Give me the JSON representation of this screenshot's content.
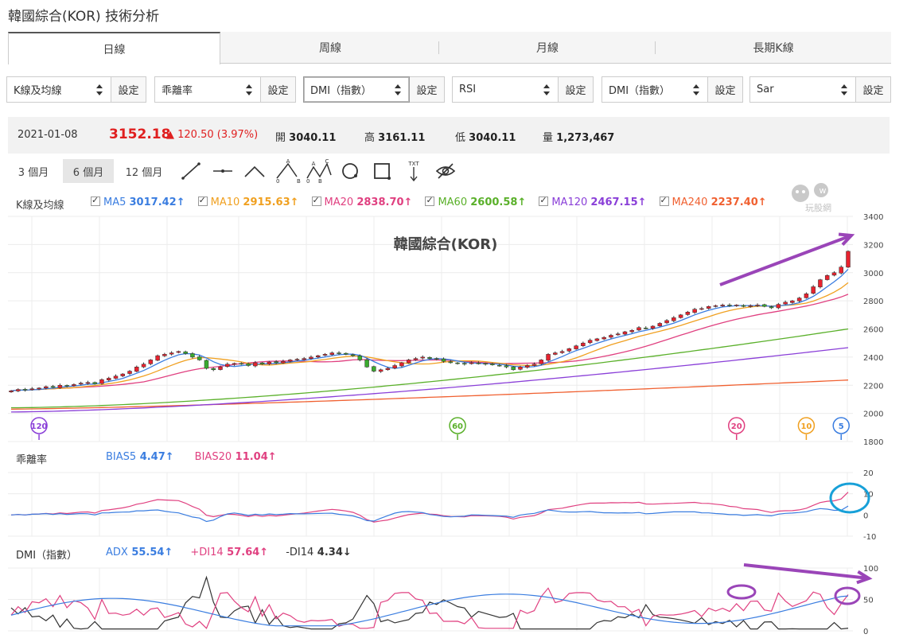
{
  "title": "韓國綜合(KOR) 技術分析",
  "tabs": [
    {
      "label": "日線",
      "active": true
    },
    {
      "label": "周線",
      "active": false
    },
    {
      "label": "月線",
      "active": false
    },
    {
      "label": "長期K線",
      "active": false
    }
  ],
  "controls": [
    {
      "label": "K線及均線",
      "set": "設定",
      "active": false
    },
    {
      "label": "乖離率",
      "set": "設定",
      "active": false
    },
    {
      "label": "DMI（指數）",
      "set": "設定",
      "active": true
    },
    {
      "label": "RSI",
      "set": "設定",
      "active": false
    },
    {
      "label": "DMI（指數）",
      "set": "設定",
      "active": false
    },
    {
      "label": "Sar",
      "set": "設定",
      "active": false
    }
  ],
  "quote": {
    "date": "2021-01-08",
    "price": "3152.18",
    "change": "▲ 120.50 (3.97%)",
    "open_label": "開",
    "open": "3040.11",
    "high_label": "高",
    "high": "3161.11",
    "low_label": "低",
    "low": "3040.11",
    "vol_label": "量",
    "vol": "1,273,467"
  },
  "periods": [
    {
      "label": "3 個月",
      "active": false
    },
    {
      "label": "6 個月",
      "active": true
    },
    {
      "label": "12 個月",
      "active": false
    }
  ],
  "tools": [
    "line-tool-icon",
    "horizontal-line-icon",
    "angle-tool-icon",
    "abc-pattern-icon",
    "abcd-pattern-icon",
    "circle-tool-icon",
    "rectangle-tool-icon",
    "text-tool-icon",
    "hide-drawings-icon"
  ],
  "tools_text": {
    "abc_a": "A",
    "abc_0": "0",
    "abc_b": "B",
    "abcd_a": "A",
    "abcd_c": "C",
    "abcd_0": "0",
    "abcd_b": "B",
    "text_tool": "TXT"
  },
  "ma_legend": {
    "label": "K線及均線",
    "items": [
      {
        "name": "MA5",
        "value": "3017.42↑",
        "color": "#3a7de0"
      },
      {
        "name": "MA10",
        "value": "2915.63↑",
        "color": "#f0a020"
      },
      {
        "name": "MA20",
        "value": "2838.70↑",
        "color": "#e04080"
      },
      {
        "name": "MA60",
        "value": "2600.58↑",
        "color": "#5ab02a"
      },
      {
        "name": "MA120",
        "value": "2467.15↑",
        "color": "#8a3fd8"
      },
      {
        "name": "MA240",
        "value": "2237.40↑",
        "color": "#f06030"
      }
    ]
  },
  "watermark": "玩股網",
  "bias_legend": {
    "label": "乖離率",
    "items": [
      {
        "name": "BIAS5",
        "value": "4.47↑",
        "color": "#3a7de0"
      },
      {
        "name": "BIAS20",
        "value": "11.04↑",
        "color": "#e04080"
      }
    ]
  },
  "dmi_legend": {
    "label": "DMI（指數）",
    "items": [
      {
        "name": "ADX",
        "value": "55.54↑",
        "color": "#3a7de0"
      },
      {
        "name": "+DI14",
        "value": "57.64↑",
        "color": "#e04080"
      },
      {
        "name": "-DI14",
        "value": "4.34↓",
        "color": "#333333"
      }
    ]
  },
  "chart_data": [
    {
      "type": "candlestick",
      "title": "韓國綜合(KOR)",
      "y_ticks": [
        1800,
        2000,
        2200,
        2400,
        2600,
        2800,
        3000,
        3200,
        3400
      ],
      "ylim": [
        1800,
        3400
      ],
      "ma_markers": [
        {
          "label": "120",
          "color": "#8a3fd8",
          "index": 4
        },
        {
          "label": "60",
          "color": "#5ab02a",
          "index": 64
        },
        {
          "label": "20",
          "color": "#e04080",
          "index": 104
        },
        {
          "label": "10",
          "color": "#f0a020",
          "index": 114
        },
        {
          "label": "5",
          "color": "#3a7de0",
          "index": 119
        }
      ],
      "closes": [
        2160,
        2170,
        2165,
        2175,
        2180,
        2190,
        2185,
        2200,
        2195,
        2205,
        2215,
        2220,
        2210,
        2240,
        2250,
        2265,
        2280,
        2300,
        2330,
        2350,
        2380,
        2410,
        2420,
        2430,
        2440,
        2425,
        2400,
        2380,
        2320,
        2310,
        2330,
        2350,
        2355,
        2350,
        2340,
        2360,
        2350,
        2365,
        2360,
        2370,
        2380,
        2385,
        2390,
        2400,
        2410,
        2420,
        2430,
        2425,
        2420,
        2410,
        2380,
        2330,
        2300,
        2310,
        2320,
        2340,
        2360,
        2380,
        2390,
        2400,
        2390,
        2385,
        2370,
        2360,
        2355,
        2350,
        2360,
        2355,
        2350,
        2345,
        2340,
        2330,
        2310,
        2330,
        2340,
        2350,
        2380,
        2420,
        2430,
        2440,
        2460,
        2480,
        2500,
        2520,
        2530,
        2540,
        2555,
        2565,
        2580,
        2590,
        2610,
        2605,
        2620,
        2640,
        2660,
        2680,
        2700,
        2720,
        2740,
        2745,
        2760,
        2765,
        2770,
        2765,
        2770,
        2760,
        2765,
        2770,
        2760,
        2750,
        2775,
        2790,
        2800,
        2820,
        2850,
        2900,
        2950,
        2980,
        3000,
        3040,
        3152
      ]
    },
    {
      "type": "line",
      "name": "乖離率",
      "y_ticks": [
        20,
        10,
        0,
        -10
      ],
      "ylim": [
        -10,
        20
      ]
    },
    {
      "type": "line",
      "name": "DMI",
      "y_ticks": [
        100,
        50,
        0
      ],
      "ylim": [
        0,
        100
      ]
    }
  ]
}
